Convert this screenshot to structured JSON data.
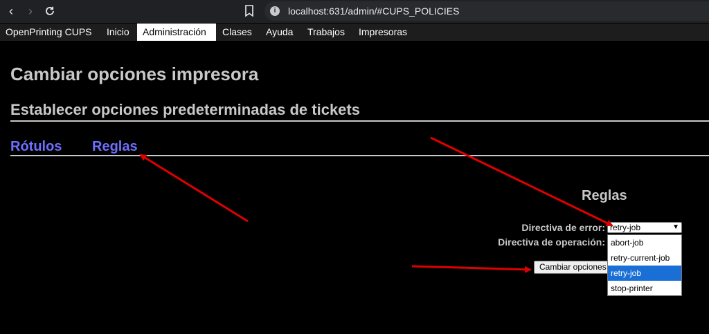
{
  "browser": {
    "url": "localhost:631/admin/#CUPS_POLICIES"
  },
  "nav": {
    "items": [
      "OpenPrinting CUPS",
      "Inicio",
      "Administración",
      "Clases",
      "Ayuda",
      "Trabajos",
      "Impresoras"
    ],
    "active": "Administración"
  },
  "page": {
    "title": "Cambiar opciones impresora",
    "subtitle": "Establecer opciones predeterminadas de tickets",
    "tabs": [
      "Rótulos",
      "Reglas"
    ]
  },
  "policies": {
    "heading": "Reglas",
    "error_label": "Directiva de error:",
    "operation_label": "Directiva de operación:",
    "error_value": "retry-job",
    "options": [
      "abort-job",
      "retry-current-job",
      "retry-job",
      "stop-printer"
    ],
    "selected_option": "retry-job",
    "submit_label": "Cambiar opciones predeterminadas"
  },
  "annotation_color": "#e00000"
}
